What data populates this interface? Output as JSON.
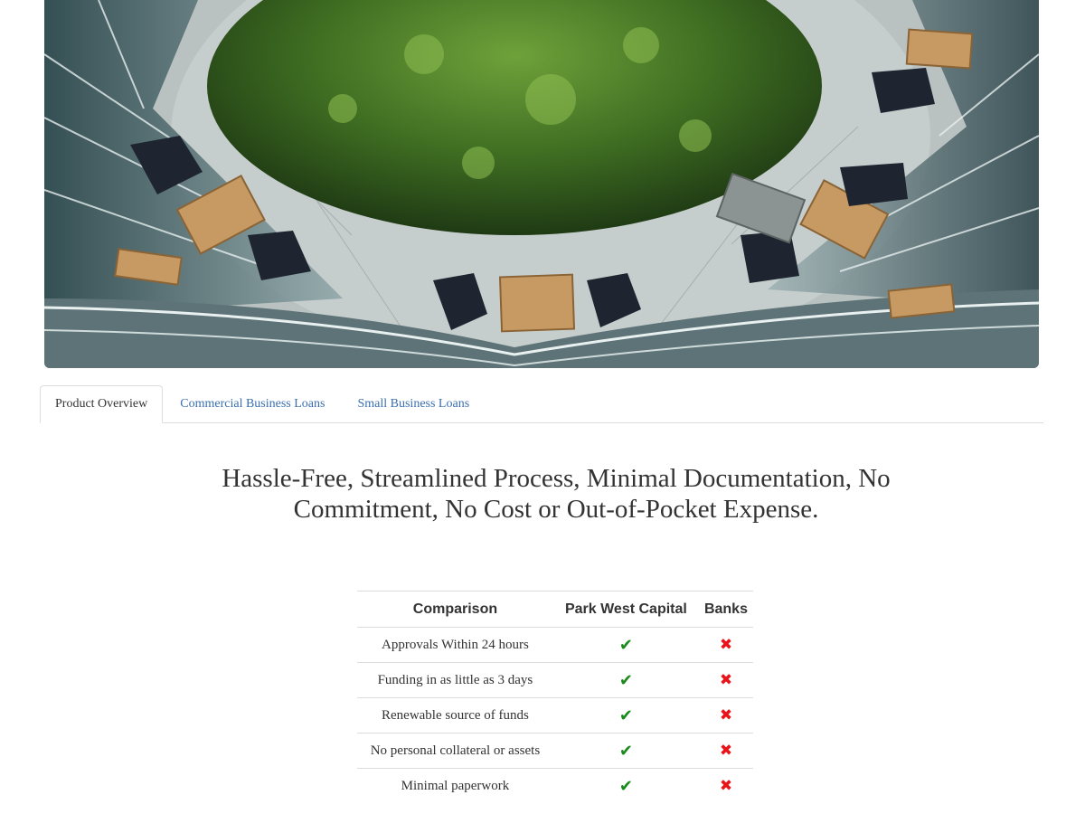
{
  "hero": {
    "image": "aerial-courtyard-photo"
  },
  "tabs": [
    {
      "label": "Product Overview",
      "active": true
    },
    {
      "label": "Commercial Business Loans",
      "active": false
    },
    {
      "label": "Small Business Loans",
      "active": false
    }
  ],
  "headline": "Hassle-Free, Streamlined Process, Minimal Documentation, No Commitment, No Cost or Out-of-Pocket Expense.",
  "comparison": {
    "headers": [
      "Comparison",
      "Park West Capital",
      "Banks"
    ],
    "rows": [
      {
        "feature": "Approvals Within 24 hours",
        "park_west": "check-icon",
        "banks": "cross-icon"
      },
      {
        "feature": "Funding in as little as 3 days",
        "park_west": "check-icon",
        "banks": "cross-icon"
      },
      {
        "feature": "Renewable source of funds",
        "park_west": "check-icon",
        "banks": "cross-icon"
      },
      {
        "feature": "No personal collateral or assets",
        "park_west": "check-icon",
        "banks": "cross-icon"
      },
      {
        "feature": "Minimal paperwork",
        "park_west": "check-icon",
        "banks": "cross-icon"
      }
    ],
    "colors": {
      "check": "#1a8a1a",
      "cross": "#e8141a"
    }
  }
}
